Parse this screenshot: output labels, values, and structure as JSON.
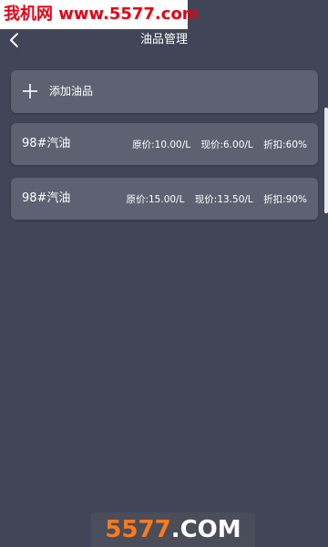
{
  "watermark": {
    "top_text": "我机网 www.5577.com",
    "bottom_num": "5577",
    "bottom_suffix": ".COM"
  },
  "header": {
    "title": "油品管理",
    "back_icon": "chevron-left-icon"
  },
  "add_button": {
    "icon": "plus-icon",
    "label": "添加油品"
  },
  "fuel_items": [
    {
      "name": "98#汽油",
      "original_price": "原价:10.00/L",
      "current_price": "现价:6.00/L",
      "discount": "折扣:60%"
    },
    {
      "name": "98#汽油",
      "original_price": "原价:15.00/L",
      "current_price": "现价:13.50/L",
      "discount": "折扣:90%"
    }
  ],
  "colors": {
    "background": "#404657",
    "card": "#5c6272",
    "watermark_red": "#e60012",
    "watermark_orange": "#ff7a1a"
  }
}
